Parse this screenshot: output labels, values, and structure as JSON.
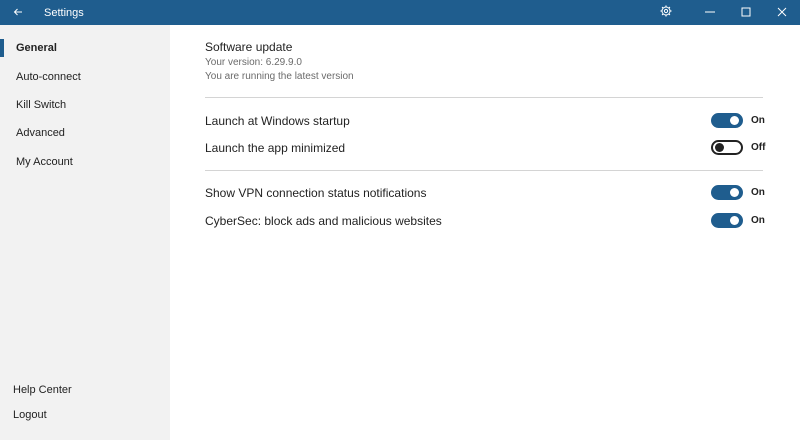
{
  "window": {
    "title": "Settings",
    "back_icon": "arrow-left-icon",
    "settings_icon": "gear-icon",
    "minimize_icon": "minimize-icon",
    "maximize_icon": "maximize-icon",
    "close_icon": "close-icon",
    "titlebar_color": "#1f5d8e"
  },
  "sidebar": {
    "items": [
      {
        "label": "General",
        "active": true
      },
      {
        "label": "Auto-connect",
        "active": false
      },
      {
        "label": "Kill Switch",
        "active": false
      },
      {
        "label": "Advanced",
        "active": false
      },
      {
        "label": "My Account",
        "active": false
      }
    ],
    "bottom_items": [
      {
        "label": "Help Center"
      },
      {
        "label": "Logout"
      }
    ]
  },
  "software_update": {
    "title": "Software update",
    "version": "Your version: 6.29.9.0",
    "status": "You are running the latest version"
  },
  "settings": [
    {
      "label": "Launch at Windows startup",
      "enabled": true,
      "state_label": "On"
    },
    {
      "label": "Launch the app minimized",
      "enabled": false,
      "state_label": "Off"
    },
    {
      "label": "Show VPN connection status notifications",
      "enabled": true,
      "state_label": "On"
    },
    {
      "label": "CyberSec: block ads and malicious websites",
      "enabled": true,
      "state_label": "On"
    }
  ],
  "colors": {
    "accent": "#1f5d8e",
    "sidebar_bg": "#f2f2f2",
    "divider": "#d4d4d4"
  }
}
